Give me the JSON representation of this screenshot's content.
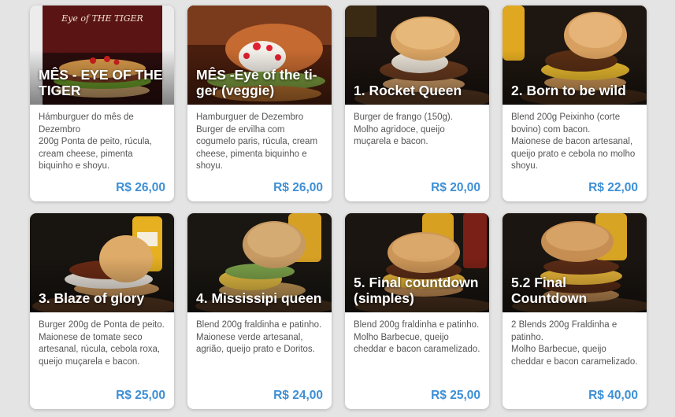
{
  "colors": {
    "price": "#3d8fd6",
    "background": "#e4e4e4",
    "card": "#ffffff"
  },
  "products": [
    {
      "title": "MÊS - EYE OF THE TIGER",
      "description": "Hámburguer do mês de Dezembro\n200g Ponta de peito, rúcula, cream cheese, pimenta biquinho e shoyu.",
      "price": "R$ 26,00",
      "photo_text": "Eye of THE TIGER"
    },
    {
      "title": "MÊS -Eye of the ti-ger (veggie)",
      "description": "Hamburguer de Dezembro\nBurger de ervilha com cogumelo paris, rúcula, cream cheese, pimenta biquinho e shoyu.",
      "price": "R$ 26,00"
    },
    {
      "title": "1. Rocket Queen",
      "description": "Burger de frango (150g).\nMolho agridoce, queijo muçarela e bacon.",
      "price": "R$ 20,00"
    },
    {
      "title": "2. Born to be wild",
      "description": "Blend 200g Peixinho (corte bovino) com bacon.\nMaionese de bacon artesanal, queijo prato e cebola no molho shoyu.",
      "price": "R$ 22,00"
    },
    {
      "title": "3. Blaze of glory",
      "description": "Burger 200g de Ponta de peito.\nMaionese de tomate seco artesanal, rúcula, cebola roxa, queijo muçarela e bacon.",
      "price": "R$ 25,00"
    },
    {
      "title": "4. Mississipi queen",
      "description": "Blend 200g fraldinha e patinho.\nMaionese verde artesanal, agrião, queijo prato e Doritos.",
      "price": "R$ 24,00"
    },
    {
      "title": "5. Final countdown (simples)",
      "description": "Blend 200g fraldinha e patinho.\nMolho Barbecue, queijo cheddar e bacon caramelizado.",
      "price": "R$ 25,00"
    },
    {
      "title": "5.2 Final Countdown",
      "description": "2 Blends 200g Fraldinha e patinho.\nMolho Barbecue, queijo cheddar e bacon caramelizado.",
      "price": "R$ 40,00"
    }
  ]
}
